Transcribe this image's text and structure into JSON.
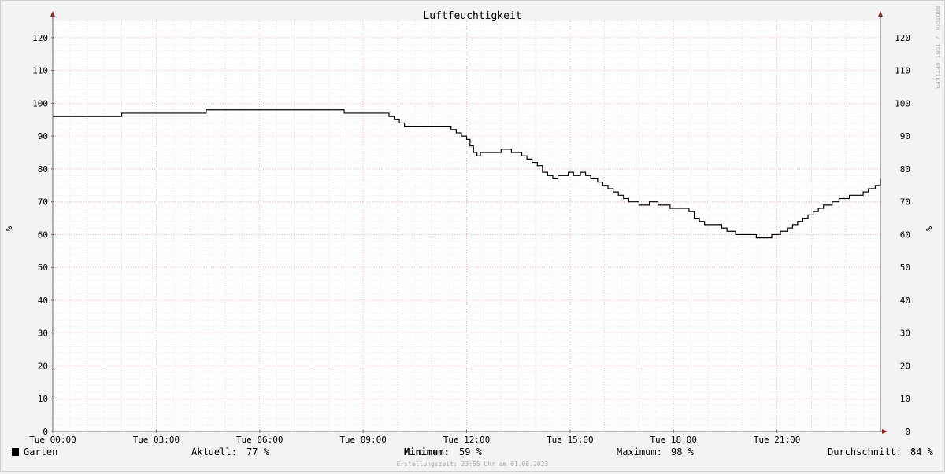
{
  "chart_data": {
    "type": "line",
    "title": "Luftfeuchtigkeit",
    "ylabel_left": "%",
    "ylabel_right": "%",
    "watermark": "RRDTOOL / TOBI OETIKER",
    "ylim": [
      0,
      125
    ],
    "yticks": [
      0,
      10,
      20,
      30,
      40,
      50,
      60,
      70,
      80,
      90,
      100,
      110,
      120
    ],
    "xlim_hours": [
      0,
      24
    ],
    "xticks": [
      {
        "hour": 0,
        "label": "Tue 00:00"
      },
      {
        "hour": 3,
        "label": "Tue 03:00"
      },
      {
        "hour": 6,
        "label": "Tue 06:00"
      },
      {
        "hour": 9,
        "label": "Tue 09:00"
      },
      {
        "hour": 12,
        "label": "Tue 12:00"
      },
      {
        "hour": 15,
        "label": "Tue 15:00"
      },
      {
        "hour": 18,
        "label": "Tue 18:00"
      },
      {
        "hour": 21,
        "label": "Tue 21:00"
      }
    ],
    "grid": true,
    "series": [
      {
        "name": "Garten",
        "color": "#000000",
        "step": true,
        "x_hours": [
          0,
          2.0,
          4.45,
          8.45,
          9.75,
          9.9,
          10.05,
          10.2,
          10.35,
          11.55,
          11.7,
          11.85,
          12.0,
          12.1,
          12.2,
          12.3,
          12.4,
          12.5,
          12.6,
          13.0,
          13.3,
          13.6,
          13.75,
          13.9,
          14.05,
          14.2,
          14.35,
          14.5,
          14.65,
          14.95,
          15.1,
          15.3,
          15.45,
          15.6,
          15.8,
          15.95,
          16.1,
          16.25,
          16.4,
          16.55,
          16.7,
          17.0,
          17.3,
          17.45,
          17.55,
          17.9,
          18.0,
          18.45,
          18.6,
          18.75,
          18.9,
          19.4,
          19.55,
          19.8,
          19.95,
          20.4,
          20.6,
          20.85,
          21.1,
          21.3,
          21.45,
          21.6,
          21.75,
          21.9,
          22.05,
          22.2,
          22.35,
          22.6,
          22.8,
          23.1,
          23.5,
          23.65,
          23.85,
          24.0
        ],
        "values": [
          96,
          97,
          98,
          97,
          96,
          95,
          94,
          93,
          93,
          92,
          91,
          90,
          89,
          87,
          85,
          84,
          85,
          85,
          85,
          86,
          85,
          84,
          83,
          82,
          81,
          79,
          78,
          77,
          78,
          79,
          78,
          79,
          78,
          77,
          76,
          75,
          74,
          73,
          72,
          71,
          70,
          69,
          70,
          70,
          69,
          68,
          68,
          67,
          65,
          64,
          63,
          62,
          61,
          60,
          60,
          59,
          59,
          60,
          61,
          62,
          63,
          64,
          65,
          66,
          67,
          68,
          69,
          70,
          71,
          72,
          73,
          74,
          75,
          76,
          77
        ],
        "summary": {
          "aktuell": "77 %",
          "minimum": "59 %",
          "maximum": "98 %",
          "durchschnitt": "84 %"
        }
      }
    ]
  },
  "legend": {
    "series_label": "Garten",
    "aktuell_label": "Aktuell:",
    "aktuell_value": "77 %",
    "minimum_label": "Minimum:",
    "minimum_value": "59 %",
    "maximum_label": "Maximum:",
    "maximum_value": "98 %",
    "durchschnitt_label": "Durchschnitt:",
    "durchschnitt_value": "84 %",
    "swatch_color": "#000000"
  },
  "footer": {
    "creation_text": "Erstellungszeit: 23:55 Uhr am 01.08.2023"
  },
  "colors": {
    "minor_grid": "#d9d9d9",
    "major_grid": "#f0a0a0",
    "axis_arrow": "#a02020",
    "line": "#000000"
  }
}
